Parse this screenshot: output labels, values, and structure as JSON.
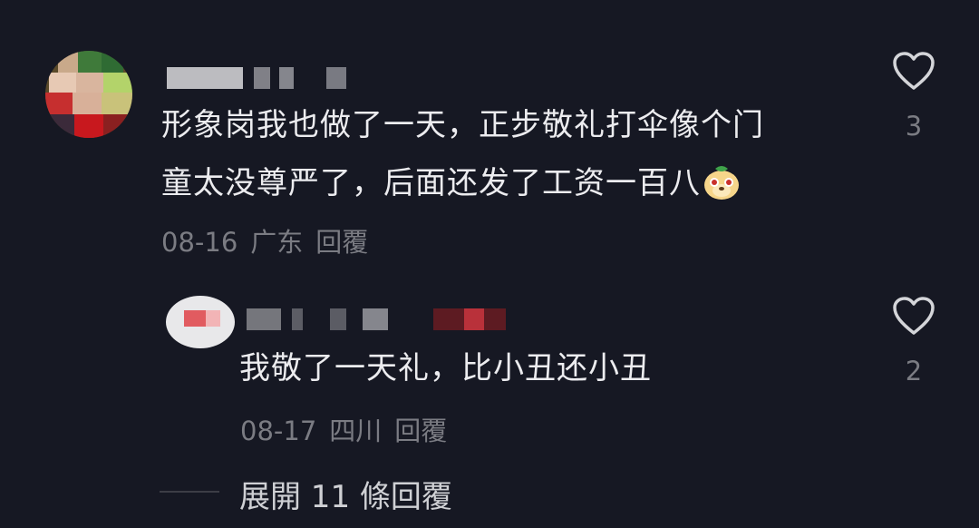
{
  "comments": [
    {
      "text_line1": "形象岗我也做了一天，正步敬礼打伞像个门",
      "text_line2": "童太没尊严了，后面还发了工资一百八",
      "emoji": "smiling-dog-emoji",
      "date": "08-16",
      "location": "广东",
      "reply_label": "回覆",
      "likes": "3"
    },
    {
      "text": "我敬了一天礼，比小丑还小丑",
      "date": "08-17",
      "location": "四川",
      "reply_label": "回覆",
      "likes": "2"
    }
  ],
  "expand_replies": "展開 11 條回覆",
  "icons": {
    "like": "heart-outline-icon"
  },
  "colors": {
    "background": "#161823",
    "text": "#ececef",
    "meta": "#7b7c83"
  }
}
